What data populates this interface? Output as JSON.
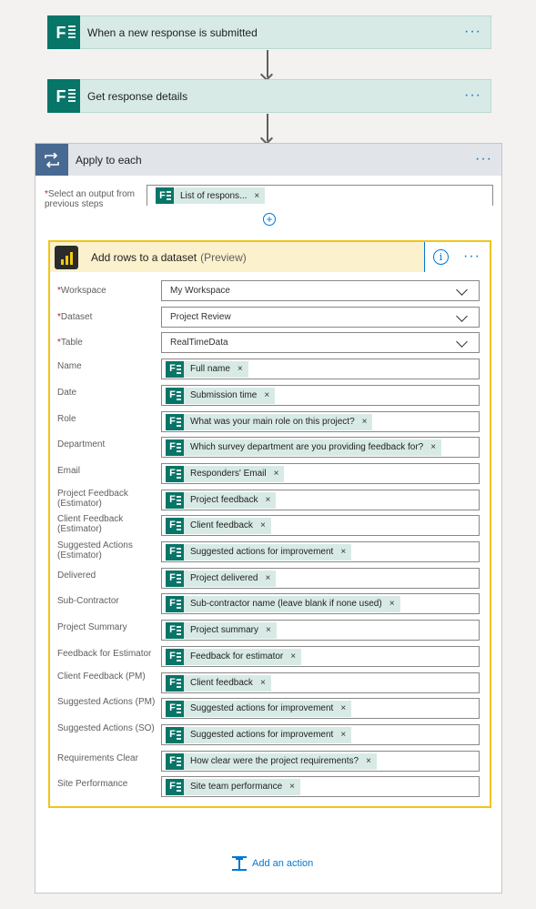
{
  "colors": {
    "forms_green": "#077568",
    "trigger_bg": "#d8eae6",
    "apply_header_bg": "#e1e4e8",
    "pbi_border": "#f0c419",
    "link_blue": "#0078d4"
  },
  "steps": [
    {
      "title": "When a new response is submitted",
      "icon": "microsoft-forms-icon",
      "more": "···"
    },
    {
      "title": "Get response details",
      "icon": "microsoft-forms-icon",
      "more": "···"
    }
  ],
  "apply_to_each": {
    "title": "Apply to each",
    "more": "···",
    "select_label_required": "*",
    "select_label": "Select an output from previous steps",
    "select_token": "List of respons...",
    "token_remove": "×",
    "add_symbol": "+"
  },
  "action": {
    "title": "Add rows to a dataset",
    "preview": "(Preview)",
    "info_symbol": "i",
    "more": "···",
    "dropdowns": [
      {
        "label": "Workspace",
        "required": "*",
        "value": "My Workspace"
      },
      {
        "label": "Dataset",
        "required": "*",
        "value": "Project Review"
      },
      {
        "label": "Table",
        "required": "*",
        "value": "RealTimeData"
      }
    ],
    "fields": [
      {
        "label": "Name",
        "token": "Full name"
      },
      {
        "label": "Date",
        "token": "Submission time"
      },
      {
        "label": "Role",
        "token": "What was your main role on this project?"
      },
      {
        "label": "Department",
        "token": "Which survey department are you providing feedback for?"
      },
      {
        "label": "Email",
        "token": "Responders' Email"
      },
      {
        "label": "Project Feedback (Estimator)",
        "token": "Project feedback"
      },
      {
        "label": "Client Feedback (Estimator)",
        "token": "Client feedback"
      },
      {
        "label": "Suggested Actions (Estimator)",
        "token": "Suggested actions for improvement"
      },
      {
        "label": "Delivered",
        "token": "Project delivered"
      },
      {
        "label": "Sub-Contractor",
        "token": "Sub-contractor name (leave blank if none used)"
      },
      {
        "label": "Project Summary",
        "token": "Project summary"
      },
      {
        "label": "Feedback for Estimator",
        "token": "Feedback for estimator"
      },
      {
        "label": "Client Feedback (PM)",
        "token": "Client feedback"
      },
      {
        "label": "Suggested Actions (PM)",
        "token": "Suggested actions for improvement"
      },
      {
        "label": "Suggested Actions (SO)",
        "token": "Suggested actions for improvement"
      },
      {
        "label": "Requirements Clear",
        "token": "How clear were the project requirements?"
      },
      {
        "label": "Site Performance",
        "token": "Site team performance"
      }
    ]
  },
  "add_action_label": "Add an action"
}
